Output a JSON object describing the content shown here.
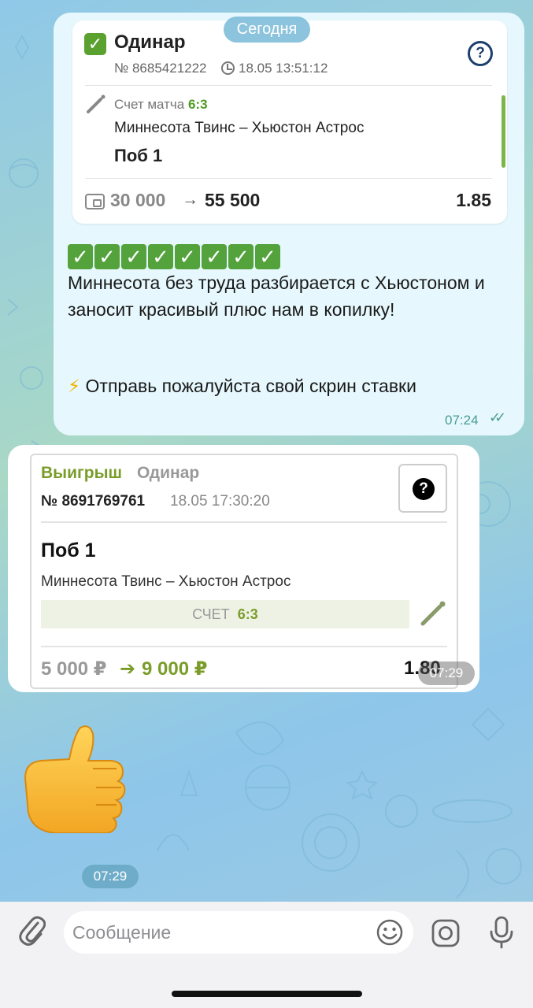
{
  "date_separator": "Сегодня",
  "message1": {
    "bet_card": {
      "title": "Одинар",
      "number": "№ 8685421222",
      "datetime": "18.05 13:51:12",
      "score_label": "Счет матча",
      "score": "6:3",
      "teams": "Миннесота Твинс – Хьюстон Астрос",
      "pick": "Поб 1",
      "stake": "30 000",
      "arrow": "→",
      "payout": "55 500",
      "odds": "1.85"
    },
    "checkmarks": [
      "✓",
      "✓",
      "✓",
      "✓",
      "✓",
      "✓",
      "✓",
      "✓"
    ],
    "text": "Миннесота без труда разбирается с Хьюстоном и заносит красивый плюс нам в копилку!",
    "cta_icon": "⚡",
    "cta": "Отправь пожалуйста свой скрин ставки",
    "time": "07:24",
    "ticks": "✓✓"
  },
  "message2": {
    "status": "Выигрыш",
    "type": "Одинар",
    "number": "№ 8691769761",
    "datetime": "18.05 17:30:20",
    "help_icon": "?",
    "pick": "Поб 1",
    "teams": "Миннесота Твинс – Хьюстон Астрос",
    "score_label": "СЧЕТ",
    "score": "6:3",
    "stake": "5 000 ₽",
    "arrow": "➔",
    "payout": "9 000 ₽",
    "odds": "1.80",
    "time": "07:29"
  },
  "message3": {
    "sticker": "thumbs-up-sticker",
    "time": "07:29"
  },
  "input": {
    "placeholder": "Сообщение"
  },
  "colors": {
    "accent_green": "#5aa12f",
    "win_green": "#7a9d2a",
    "outgoing_bubble": "#e6f8fd",
    "tick_color": "#4a9c93"
  }
}
